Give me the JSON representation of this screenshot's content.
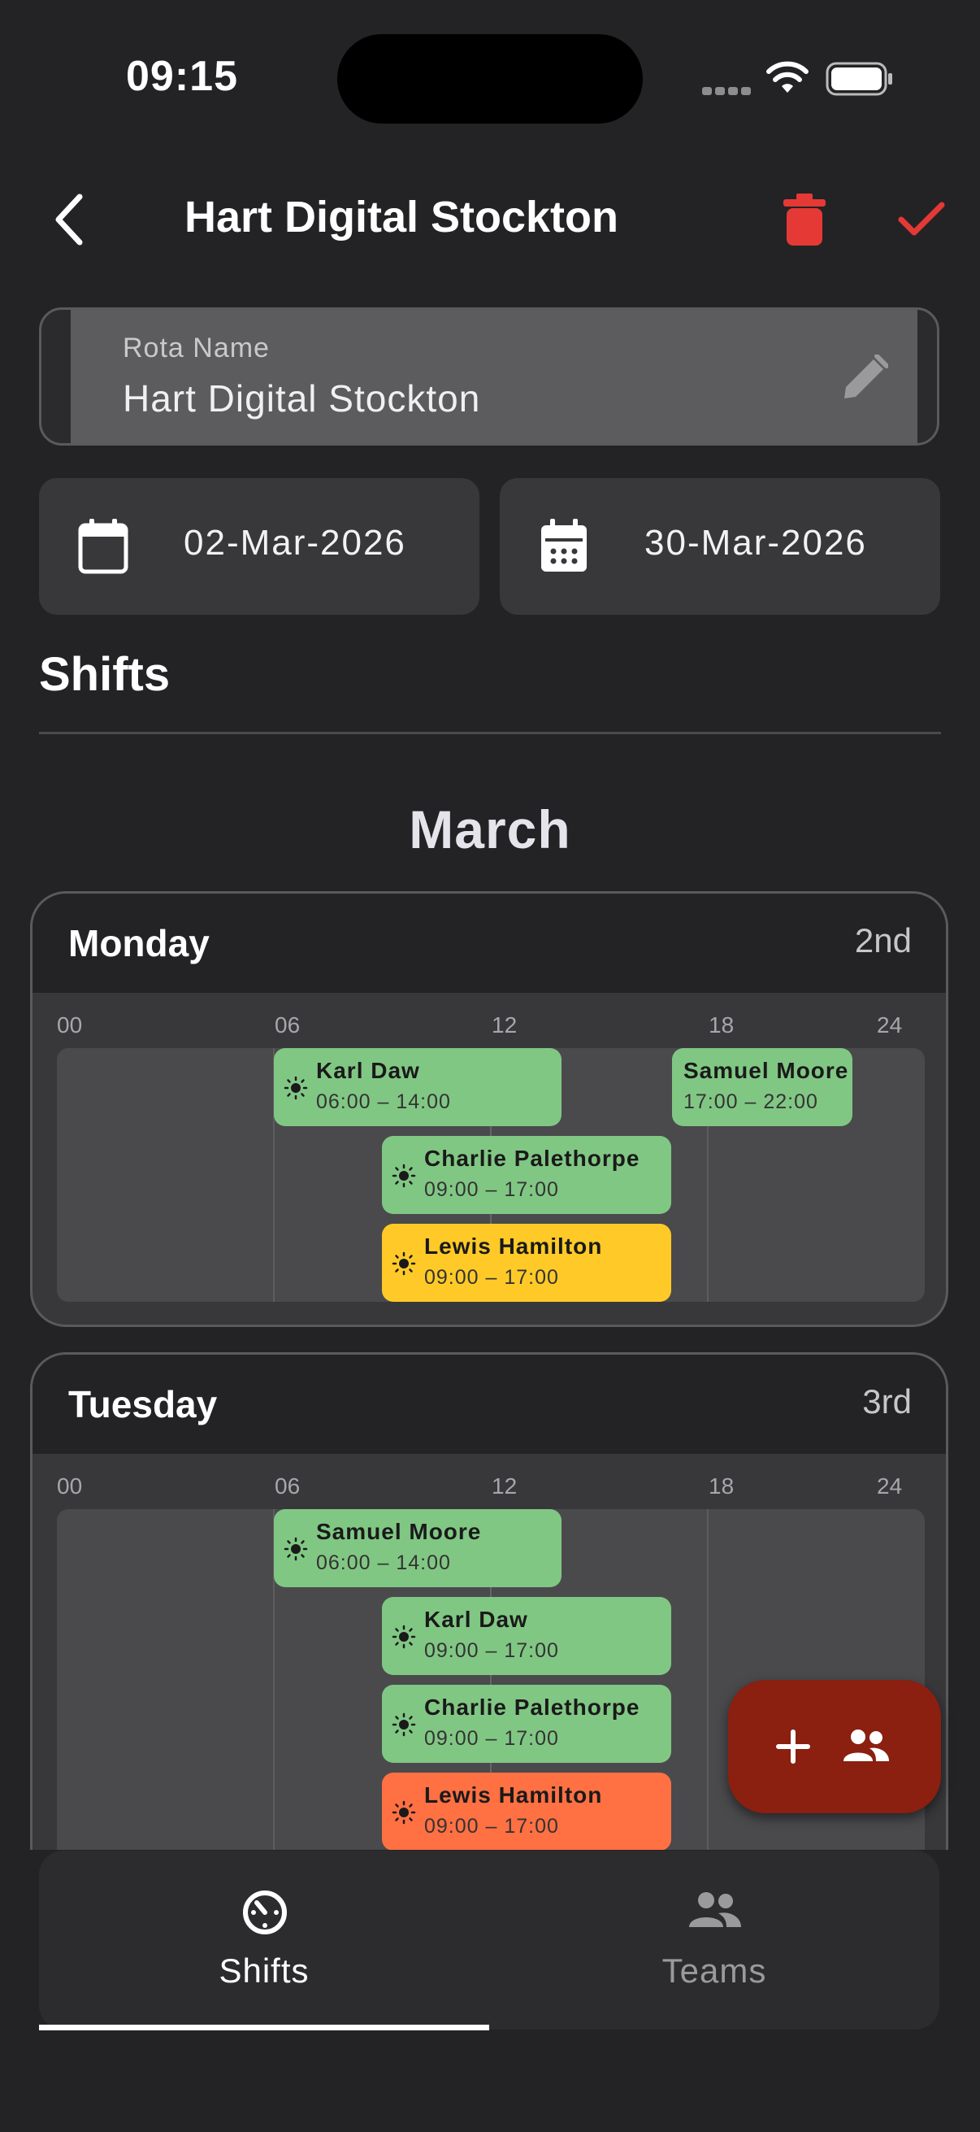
{
  "status_bar": {
    "time": "09:15"
  },
  "header": {
    "title": "Hart Digital Stockton"
  },
  "rota_field": {
    "label": "Rota Name",
    "value": "Hart Digital Stockton"
  },
  "dates": {
    "start": "02-Mar-2026",
    "end": "30-Mar-2026"
  },
  "section_title": "Shifts",
  "month": "March",
  "hours": [
    "00",
    "06",
    "12",
    "18",
    "24"
  ],
  "days": [
    {
      "name": "Monday",
      "date": "2nd",
      "shifts": [
        {
          "name": "Karl Daw",
          "time": "06:00 – 14:00",
          "color": "#81c784",
          "icon": "sun-icon"
        },
        {
          "name": "Samuel Moore",
          "time": "17:00 – 22:00",
          "color": "#81c784"
        },
        {
          "name": "Charlie Palethorpe",
          "time": "09:00 – 17:00",
          "color": "#81c784",
          "icon": "sun-icon"
        },
        {
          "name": "Lewis Hamilton",
          "time": "09:00 – 17:00",
          "color": "#ffca28",
          "icon": "sun-icon"
        }
      ]
    },
    {
      "name": "Tuesday",
      "date": "3rd",
      "shifts": [
        {
          "name": "Samuel Moore",
          "time": "06:00 – 14:00",
          "color": "#81c784",
          "icon": "sun-icon"
        },
        {
          "name": "Karl Daw",
          "time": "09:00 – 17:00",
          "color": "#81c784",
          "icon": "sun-icon"
        },
        {
          "name": "Charlie Palethorpe",
          "time": "09:00 – 17:00",
          "color": "#81c784",
          "icon": "sun-icon"
        },
        {
          "name": "Lewis Hamilton",
          "time": "09:00 – 17:00",
          "color": "#ff7043",
          "icon": "sun-icon"
        }
      ]
    }
  ],
  "fab": {
    "icons": [
      "plus-icon",
      "people-icon"
    ],
    "color": "#8b1f10"
  },
  "nav": {
    "tabs": [
      {
        "label": "Shifts",
        "icon": "timer-icon",
        "active": true
      },
      {
        "label": "Teams",
        "icon": "people-icon",
        "active": false
      }
    ]
  },
  "colors": {
    "delete": "#e53935",
    "confirm": "#e53935",
    "accent_fab": "#8b1f10"
  }
}
